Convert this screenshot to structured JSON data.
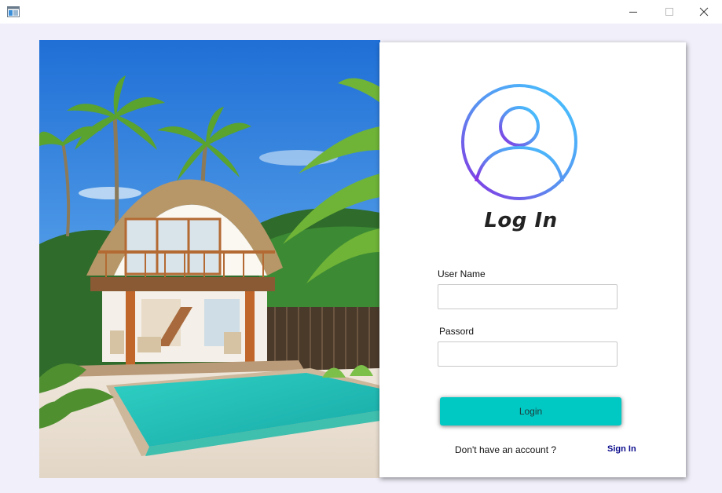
{
  "window": {
    "icon": "app-window-icon",
    "controls": [
      "minimize-icon",
      "maximize-icon",
      "close-icon"
    ]
  },
  "hero": {
    "icon": "beach-villa-image"
  },
  "login": {
    "avatar_icon": "user-avatar-icon",
    "title": "Log In",
    "username_label": "User Name",
    "username_value": "",
    "password_label": "Passord",
    "password_value": "",
    "login_button": "Login",
    "no_account_text": "Don't have an account ?",
    "signin_link": "Sign In"
  },
  "colors": {
    "background": "#f1eff9",
    "button": "#00c9c4",
    "link": "#0b0b8c",
    "avatar_gradient_start": "#44c8ff",
    "avatar_gradient_end": "#8a2be2"
  }
}
